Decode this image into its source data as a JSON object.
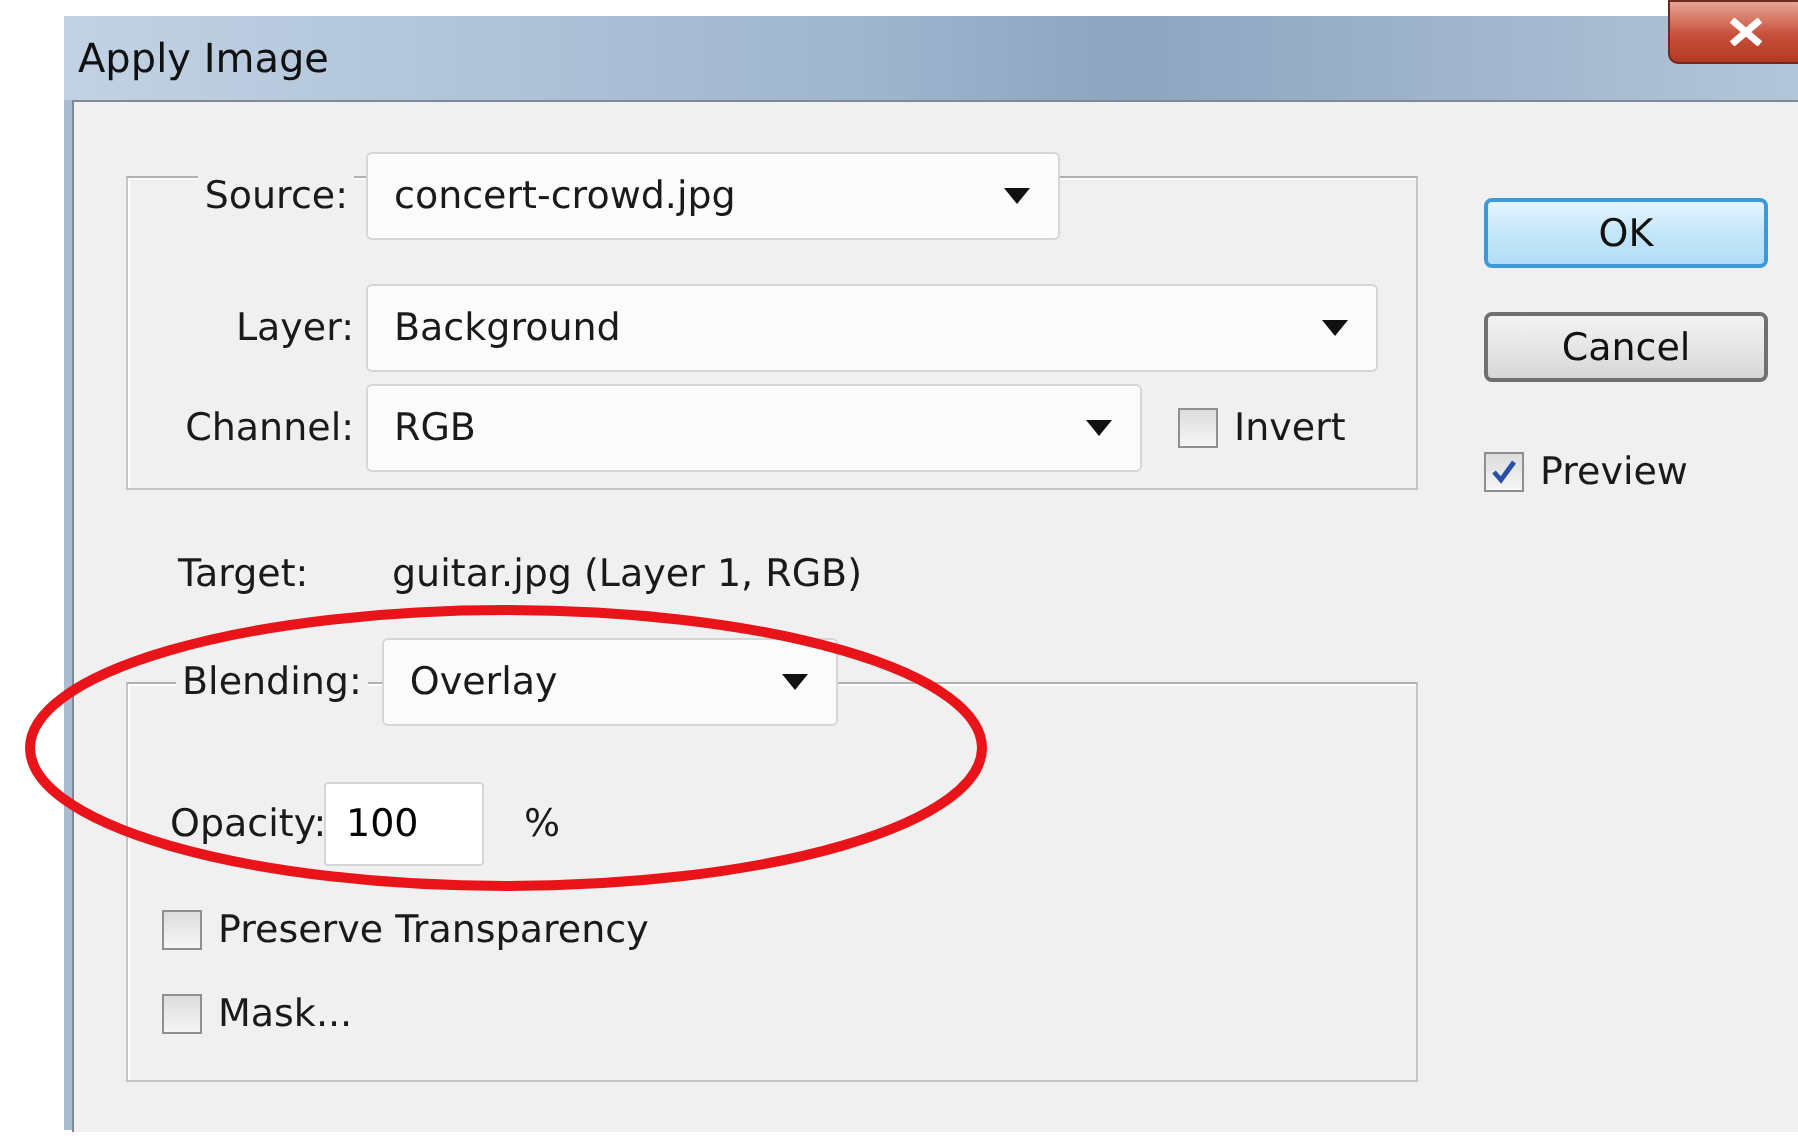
{
  "window": {
    "title": "Apply Image"
  },
  "source": {
    "label": "Source:",
    "file": "concert-crowd.jpg",
    "layer_label": "Layer:",
    "layer": "Background",
    "channel_label": "Channel:",
    "channel": "RGB",
    "invert": {
      "label": "Invert",
      "checked": false
    }
  },
  "target": {
    "label": "Target:",
    "value": "guitar.jpg (Layer 1, RGB)"
  },
  "blending": {
    "label": "Blending:",
    "mode": "Overlay",
    "opacity_label": "Opacity:",
    "opacity": "100",
    "unit": "%",
    "options": [
      {
        "label": "Preserve Transparency",
        "checked": false
      },
      {
        "label": "Mask...",
        "checked": false
      }
    ]
  },
  "buttons": [
    {
      "label": "OK",
      "default": true
    },
    {
      "label": "Cancel",
      "default": false
    }
  ],
  "preview": {
    "label": "Preview",
    "checked": true
  },
  "highlight": {
    "kind": "ellipse"
  }
}
